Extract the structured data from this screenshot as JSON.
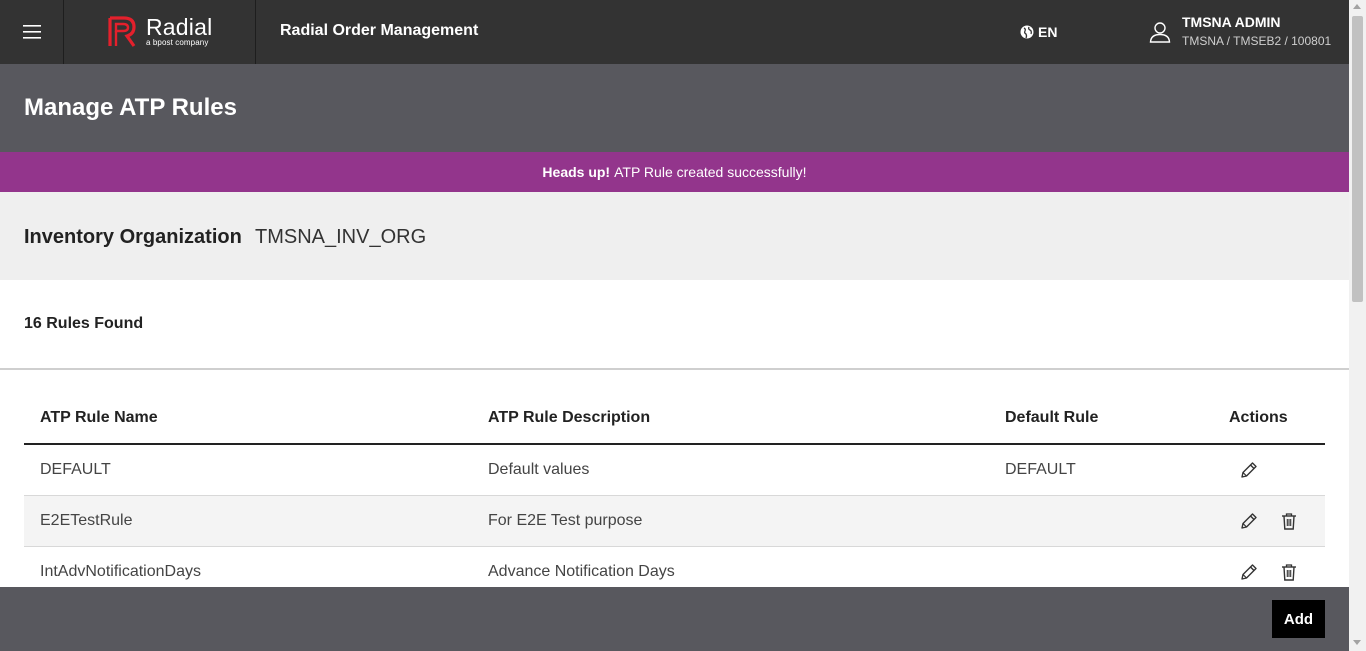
{
  "header": {
    "logo_text": "Radial",
    "logo_sub": "a bpost company",
    "app_title": "Radial Order Management",
    "language": "EN",
    "user_name": "TMSNA ADMIN",
    "user_org": "TMSNA / TMSEB2 / 100801",
    "icons": [
      "hamburger-icon",
      "radial-logo",
      "globe-icon",
      "user-icon"
    ]
  },
  "page": {
    "title": "Manage ATP Rules"
  },
  "alert": {
    "strong": "Heads up!",
    "message": "ATP Rule created successfully!"
  },
  "inventory": {
    "label": "Inventory Organization",
    "value": "TMSNA_INV_ORG"
  },
  "results": {
    "count_text": "16 Rules Found"
  },
  "table": {
    "columns": [
      "ATP Rule Name",
      "ATP Rule Description",
      "Default Rule",
      "Actions"
    ],
    "rows": [
      {
        "name": "DEFAULT",
        "description": "Default values",
        "default_rule": "DEFAULT",
        "actions": [
          "edit-icon"
        ]
      },
      {
        "name": "E2ETestRule",
        "description": "For E2E Test purpose",
        "default_rule": "",
        "actions": [
          "edit-icon",
          "trash-icon"
        ]
      },
      {
        "name": "IntAdvNotificationDays",
        "description": "Advance Notification Days",
        "default_rule": "",
        "actions": [
          "edit-icon",
          "trash-icon"
        ]
      }
    ]
  },
  "footer": {
    "add_label": "Add"
  },
  "colors": {
    "topbar": "#333333",
    "page_header": "#58585e",
    "alert": "#93358c",
    "brand_red": "#e4202c",
    "org_band": "#efefef"
  }
}
